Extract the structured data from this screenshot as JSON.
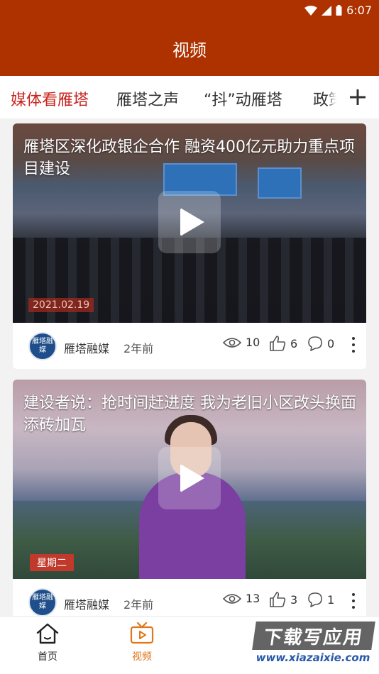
{
  "status_bar": {
    "time": "6:07"
  },
  "header": {
    "title": "视频"
  },
  "tabs": [
    {
      "label": "媒体看雁塔",
      "active": true
    },
    {
      "label": "雁塔之声",
      "active": false
    },
    {
      "label": "“抖”动雁塔",
      "active": false
    },
    {
      "label": "政策",
      "active": false
    }
  ],
  "tabs_add_icon": "plus-icon",
  "videos": [
    {
      "title": "雁塔区深化政银企合作  融资400亿元助力重点项目建设",
      "thumb_overlay": "2021.02.19",
      "source": "雁塔融媒",
      "avatar_text": "雁塔融媒",
      "time": "2年前",
      "views": "10",
      "likes": "6",
      "comments": "0"
    },
    {
      "title": "建设者说：抢时间赶进度  我为老旧小区改头换面添砖加瓦",
      "thumb_overlay": "星期二",
      "source": "雁塔融媒",
      "avatar_text": "雁塔融媒",
      "time": "2年前",
      "views": "13",
      "likes": "3",
      "comments": "1"
    }
  ],
  "bottom_nav": [
    {
      "label": "首页",
      "icon": "home-icon",
      "active": false
    },
    {
      "label": "视频",
      "icon": "video-icon",
      "active": true
    }
  ],
  "watermark": {
    "main": "下载写应用",
    "sub": "www.xiazaixie.com"
  },
  "colors": {
    "header_bg": "#ad3200",
    "tab_active": "#c8231c",
    "nav_active": "#e0761a"
  }
}
